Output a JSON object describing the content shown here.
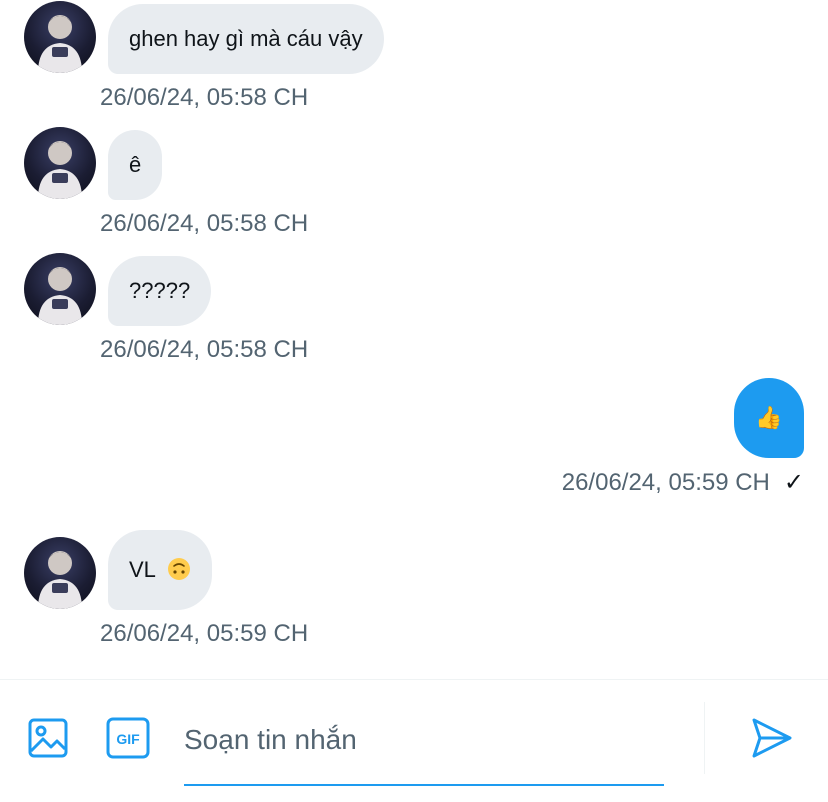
{
  "conversation": {
    "messages": [
      {
        "direction": "in",
        "text": "ghen hay gì mà cáu vậy",
        "timestamp": "26/06/24, 05:58 CH"
      },
      {
        "direction": "in",
        "text": "ê",
        "timestamp": "26/06/24, 05:58 CH"
      },
      {
        "direction": "in",
        "text": "?????",
        "timestamp": "26/06/24, 05:58 CH"
      },
      {
        "direction": "out",
        "text": "👍",
        "timestamp": "26/06/24, 05:59 CH",
        "status": "✓"
      },
      {
        "direction": "in",
        "text": "VL",
        "emoji": "upside-down-face",
        "timestamp": "26/06/24, 05:59 CH"
      }
    ]
  },
  "composer": {
    "placeholder": "Soạn tin nhắn",
    "value": "",
    "gif_label": "GIF",
    "icons": {
      "media": "image-icon",
      "gif": "gif-icon",
      "send": "send-icon"
    }
  },
  "colors": {
    "accent": "#1d9bf0",
    "incoming_bubble": "#e8ecf0",
    "text_primary": "#0f1419",
    "text_secondary": "#536471"
  }
}
